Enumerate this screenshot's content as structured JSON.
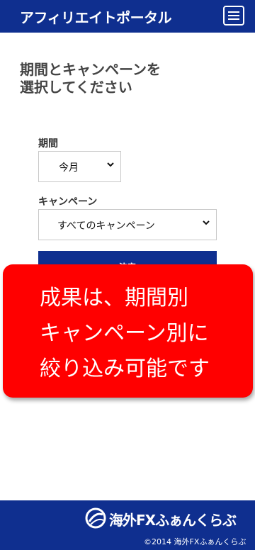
{
  "header": {
    "title": "アフィリエイトポータル",
    "menu_icon": "hamburger-menu-icon",
    "bg_color": "#0f2f8f"
  },
  "main": {
    "page_title_line1": "期間とキャンペーンを",
    "page_title_line2": "選択してください",
    "period_label": "期間",
    "period_value": "今月",
    "campaign_label": "キャンペーン",
    "campaign_value": "すべてのキャンペーン",
    "submit_label": "決定",
    "chevron_icon": "chevron-down-icon"
  },
  "callout": {
    "lines": [
      "成果は、期間別",
      "キャンペーン別に",
      "絞り込み可能です"
    ],
    "bg_color": "#ff0000"
  },
  "footer": {
    "logo_icon": "swirl-logo-icon",
    "logo_text": "海外FXふぁんくらぶ",
    "copyright": "©2014 海外FXふぁんくらぶ"
  }
}
